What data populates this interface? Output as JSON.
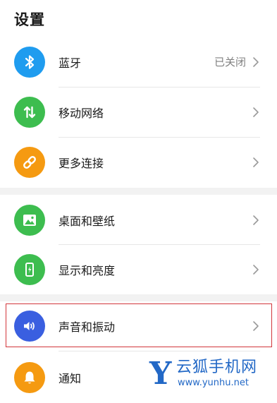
{
  "header": {
    "title": "设置"
  },
  "colors": {
    "bluetooth": "#1f9cef",
    "network": "#3dbd4f",
    "more": "#f59a11",
    "wallpaper": "#3dbd4f",
    "display": "#3dbd4f",
    "sound": "#3a5fe0",
    "notify": "#f59a11",
    "highlight_border": "#d2363b",
    "watermark": "#2268c6"
  },
  "items": [
    {
      "label": "蓝牙",
      "icon": "bluetooth-icon",
      "status": "已关闭"
    },
    {
      "label": "移动网络",
      "icon": "mobile-data-icon"
    },
    {
      "label": "更多连接",
      "icon": "link-icon"
    },
    {
      "label": "桌面和壁纸",
      "icon": "image-icon"
    },
    {
      "label": "显示和亮度",
      "icon": "phone-brightness-icon"
    },
    {
      "label": "声音和振动",
      "icon": "speaker-icon"
    },
    {
      "label": "通知",
      "icon": "bell-icon"
    }
  ],
  "watermark": {
    "letter": "Y",
    "name": "云狐手机网",
    "url": "www.yunhu.net"
  }
}
